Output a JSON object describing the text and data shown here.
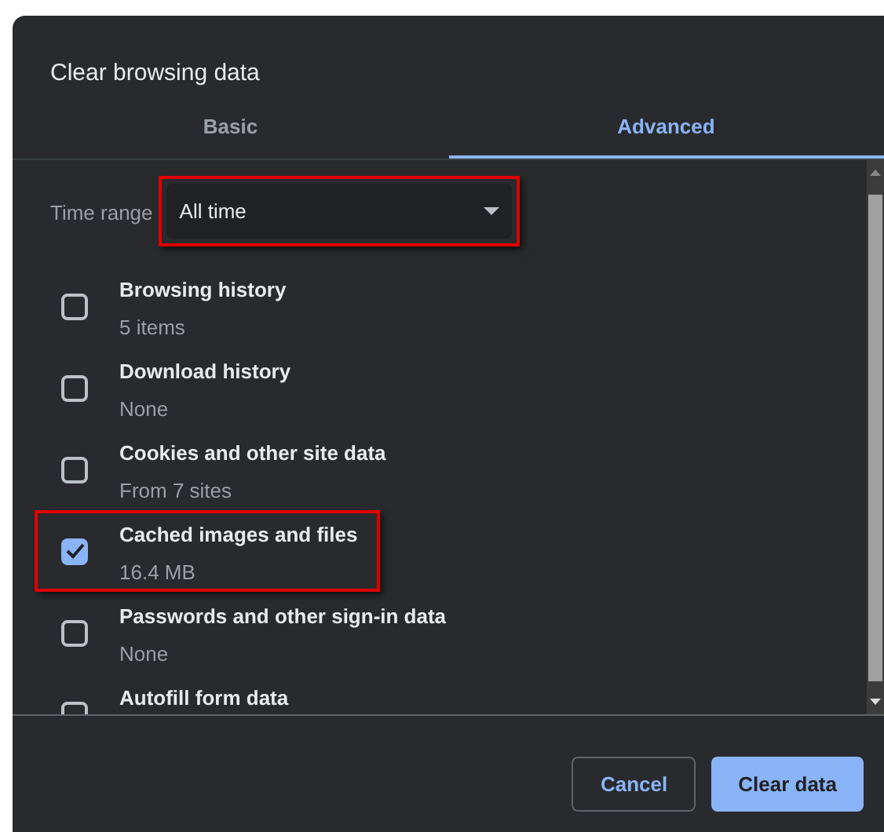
{
  "dialog": {
    "title": "Clear browsing data"
  },
  "tabs": [
    {
      "label": "Basic",
      "selected": false
    },
    {
      "label": "Advanced",
      "selected": true
    }
  ],
  "time_range": {
    "label": "Time range",
    "value": "All time",
    "highlighted": true
  },
  "items": [
    {
      "title": "Browsing history",
      "detail": "5 items",
      "checked": false,
      "highlighted": false
    },
    {
      "title": "Download history",
      "detail": "None",
      "checked": false,
      "highlighted": false
    },
    {
      "title": "Cookies and other site data",
      "detail": "From 7 sites",
      "checked": false,
      "highlighted": false
    },
    {
      "title": "Cached images and files",
      "detail": "16.4 MB",
      "checked": true,
      "highlighted": true
    },
    {
      "title": "Passwords and other sign-in data",
      "detail": "None",
      "checked": false,
      "highlighted": false
    },
    {
      "title": "Autofill form data",
      "checked": false,
      "highlighted": false
    }
  ],
  "buttons": [
    {
      "label": "Cancel",
      "kind": "secondary"
    },
    {
      "label": "Clear data",
      "kind": "primary"
    }
  ]
}
